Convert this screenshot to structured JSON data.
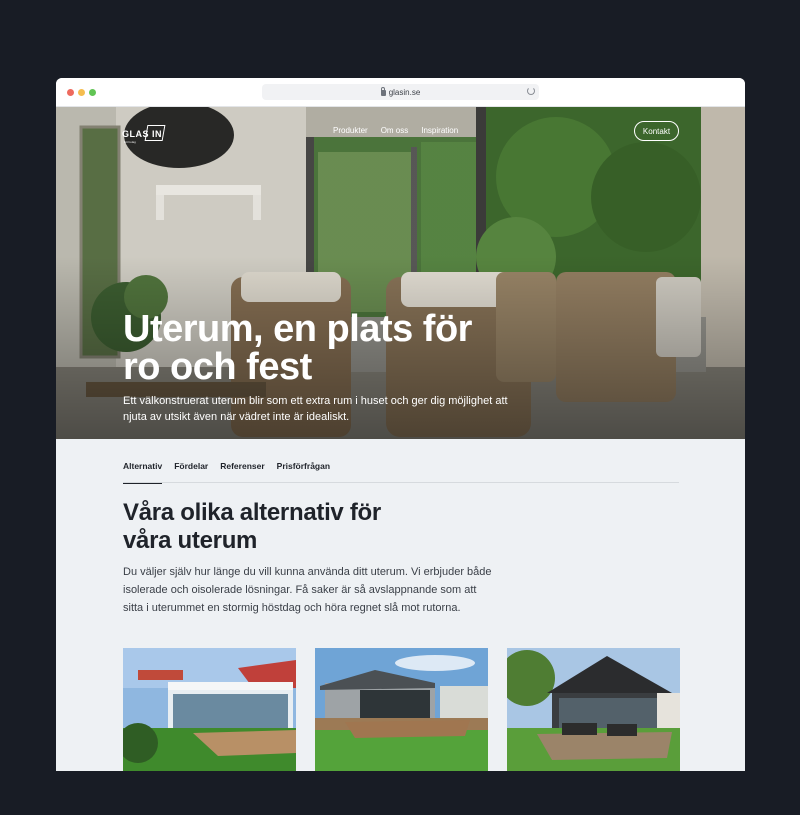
{
  "browser": {
    "url": "glasin.se"
  },
  "header": {
    "logo_text": "GLAS IN",
    "logo_sub": "Ett bolag",
    "nav": [
      "Produkter",
      "Om oss",
      "Inspiration"
    ],
    "contact_label": "Kontakt"
  },
  "hero": {
    "title": "Uterum, en plats för ro och fest",
    "subtitle": "Ett välkonstruerat uterum blir som ett extra rum i huset och ger dig möjlighet att njuta av utsikt även när vädret inte är idealiskt."
  },
  "tabs": [
    {
      "label": "Alternativ",
      "active": true
    },
    {
      "label": "Fördelar",
      "active": false
    },
    {
      "label": "Referenser",
      "active": false
    },
    {
      "label": "Prisförfrågan",
      "active": false
    }
  ],
  "section": {
    "title": "Våra olika alternativ för våra uterum",
    "body": "Du väljer själv hur länge du vill kunna använda ditt uterum. Vi erbjuder både isolerade och oisolerade lösningar. Få saker är så avslappnande som att sitta i uterummet en stormig höstdag och höra regnet slå mot rutorna."
  },
  "cards": [
    {
      "name": "uterum-white-house"
    },
    {
      "name": "uterum-grey-house"
    },
    {
      "name": "uterum-black-house"
    }
  ],
  "colors": {
    "page_background": "#181c25",
    "content_background": "#eef1f4",
    "text_dark": "#1f232a"
  }
}
